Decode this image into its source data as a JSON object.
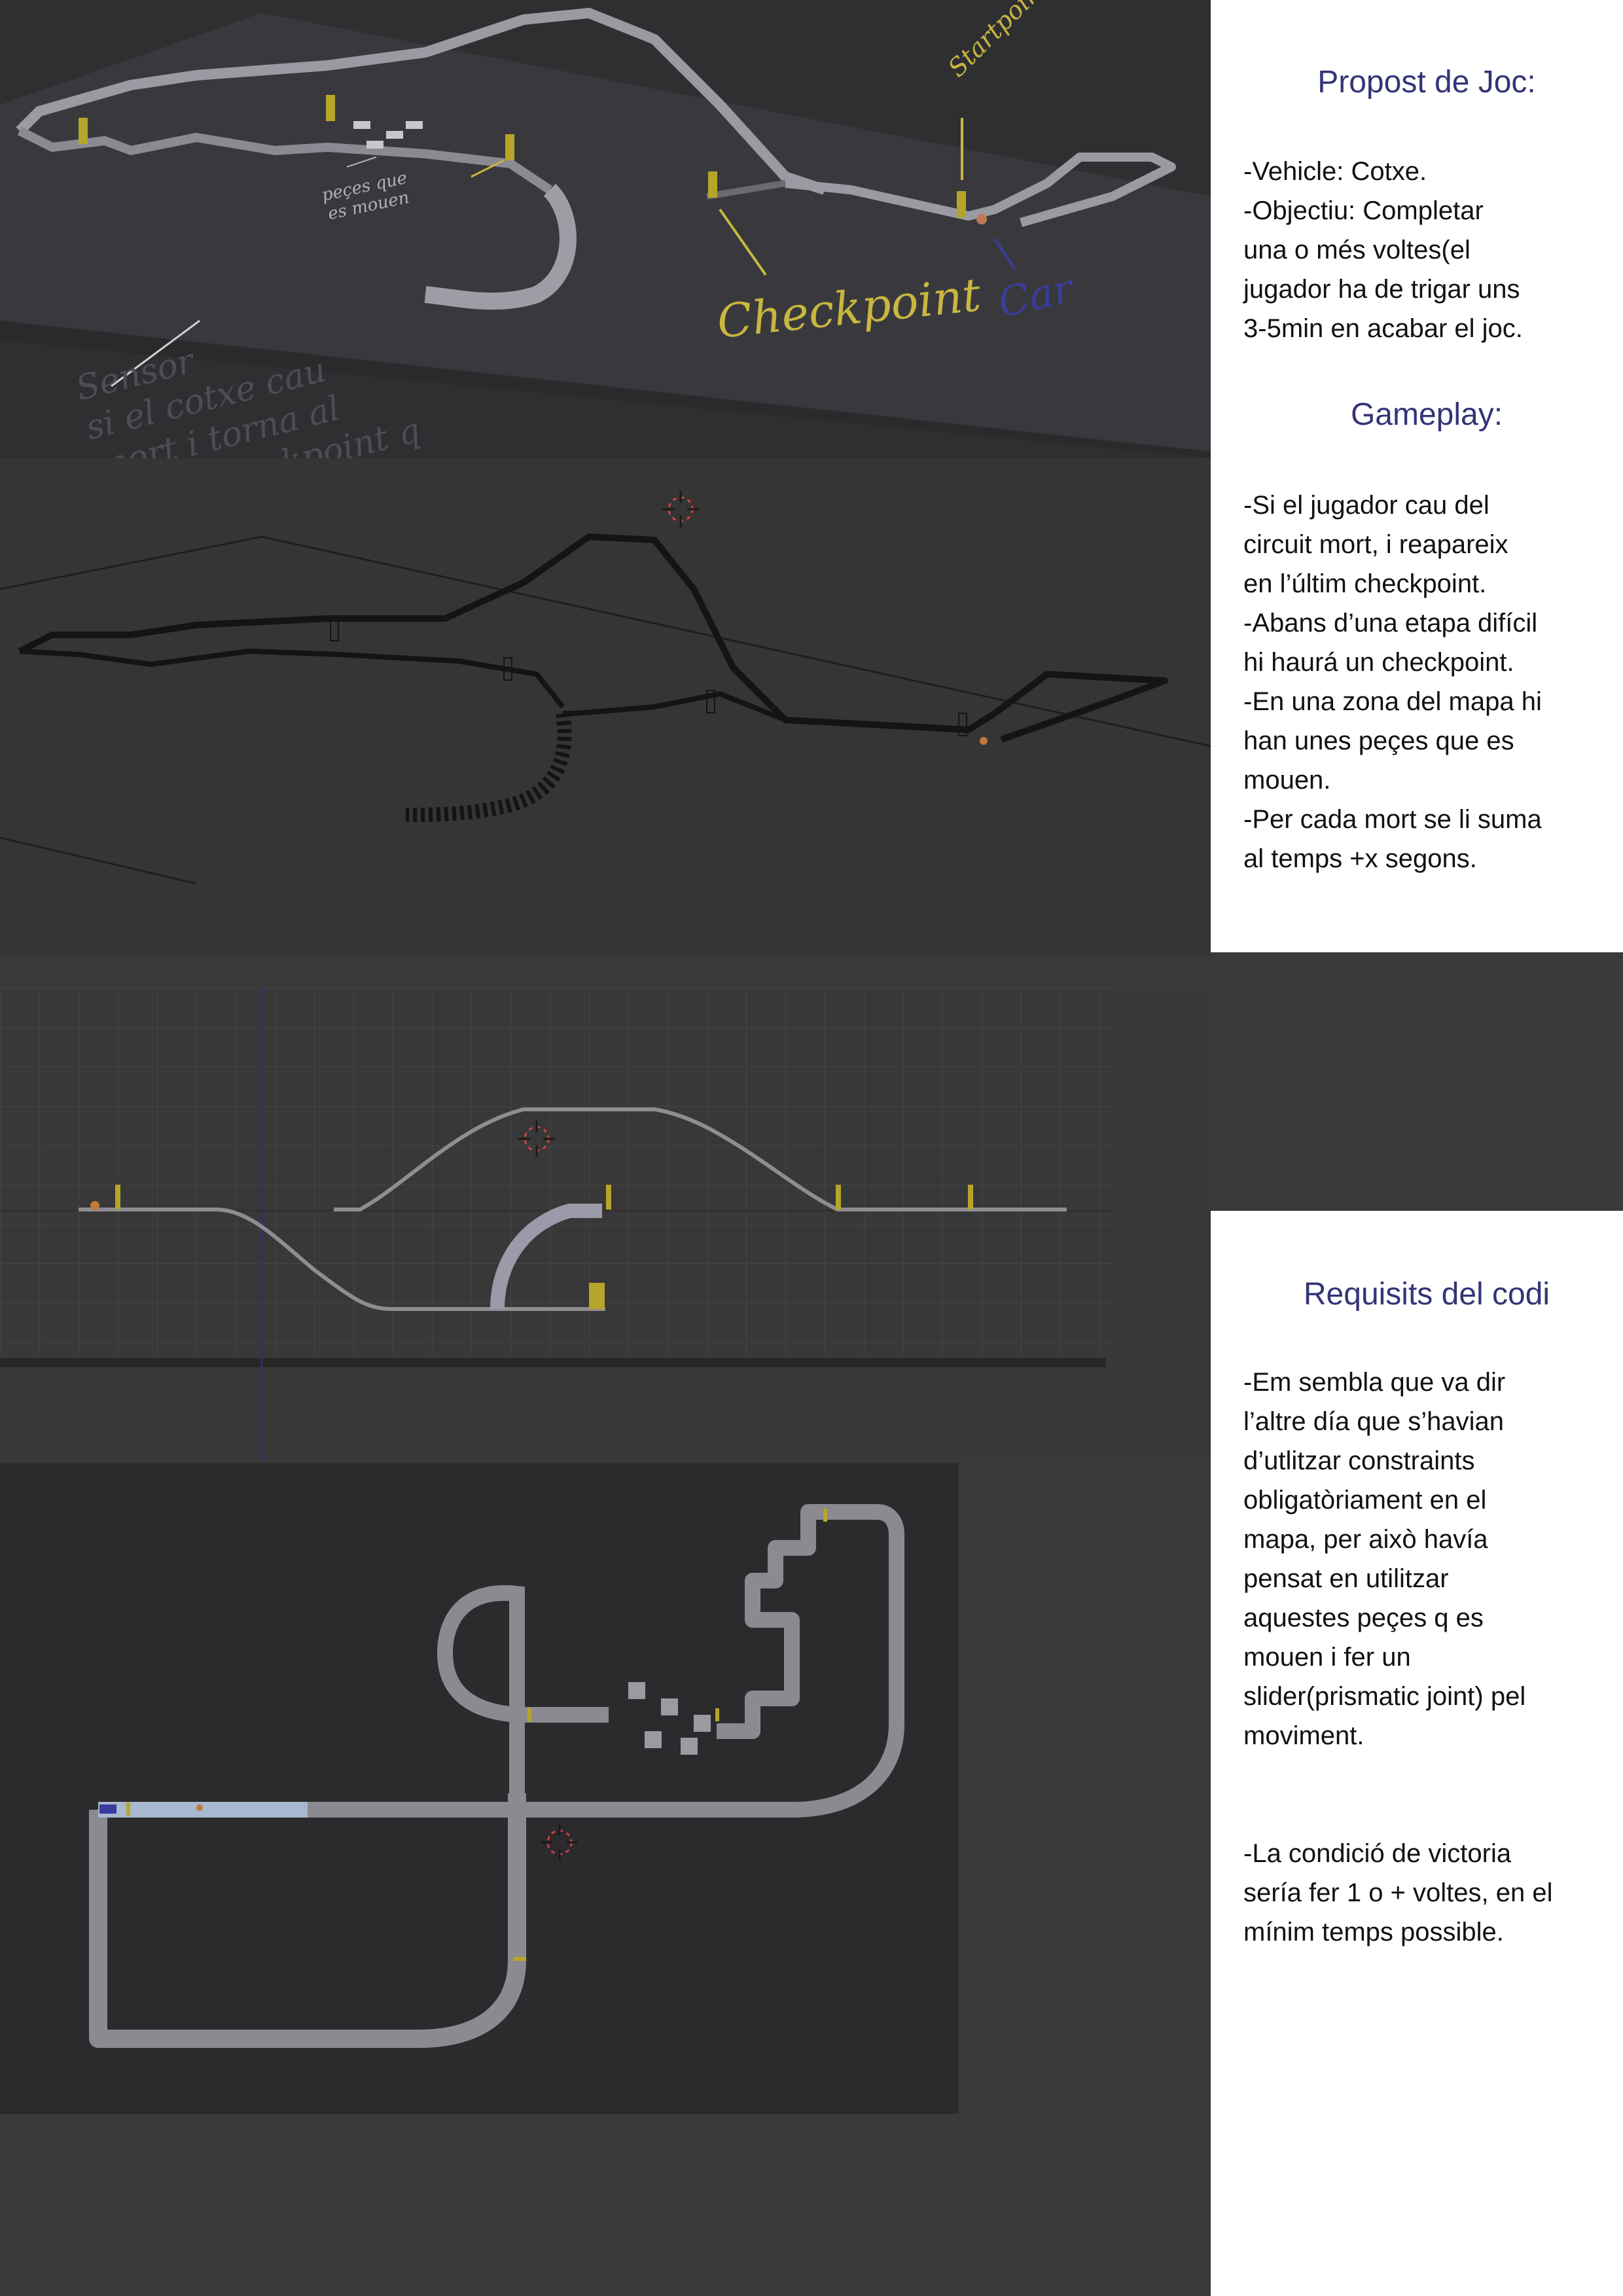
{
  "viewport_top": {
    "annotations": {
      "checkpoint": "Checkpoint",
      "car": "Car",
      "startpoint": "Startpoint",
      "moving_pieces": "peçes que\nes mouen",
      "sensor_note": "Sensor\nsi el cotxe cau\nmort i torna al\núltim checkpoint q\nha passat"
    },
    "colors": {
      "checkpoint_marker": "#b5a52a",
      "track": "#8c8c92",
      "annotation_yellow": "#c8b640",
      "annotation_blue": "#3c3c9a"
    }
  },
  "panel_top": {
    "proposal_heading": "Propost de Joc:",
    "proposal_text": "-Vehicle: Cotxe.\n-Objectiu: Completar\nuna o més voltes(el\njugador ha de trigar uns\n3-5min en acabar el joc.",
    "gameplay_heading": "Gameplay:",
    "gameplay_text": "-Si el jugador cau del\ncircuit mort, i reapareix\nen l’últim checkpoint.\n-Abans d’una etapa difícil\nhi haurá un checkpoint.\n-En una zona del mapa hi\nhan unes peçes que es\nmouen.\n-Per cada mort se li suma\nal temps +x segons."
  },
  "panel_bottom": {
    "requirements_heading": "Requisits del codi",
    "requirements_text": "-Em sembla que va dir\nl’altre día que s’havian\nd’utlitzar constraints\nobligatòriament en el\nmapa, per això havía\npensat en utilitzar\naquestes peçes q es\nmouen i fer un\nslider(prismatic joint) pel\nmoviment.",
    "victory_text": "-La condició de victoria\nsería fer 1 o + voltes, en el\nmínim temps possible."
  },
  "theme": {
    "heading_color": "#343478",
    "panel_background": "#ffffff",
    "editor_background": "#3a3a3a"
  }
}
